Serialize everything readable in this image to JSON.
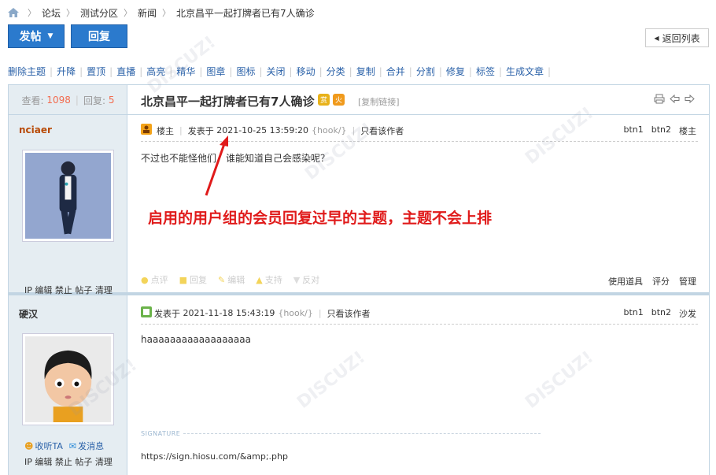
{
  "breadcrumb": {
    "items": [
      "论坛",
      "测试分区",
      "新闻",
      "北京昌平一起打牌者已有7人确诊"
    ]
  },
  "toolbar": {
    "post_label": "发帖",
    "reply_label": "回复",
    "back_label": "返回列表"
  },
  "admin_links": [
    "删除主题",
    "升降",
    "置顶",
    "直播",
    "高亮",
    "精华",
    "图章",
    "图标",
    "关闭",
    "移动",
    "分类",
    "复制",
    "合并",
    "分割",
    "修复",
    "标签",
    "生成文章"
  ],
  "thread": {
    "views_label": "查看:",
    "views": "1098",
    "replies_label": "回复:",
    "replies": "5",
    "title": "北京昌平一起打牌者已有7人确诊",
    "copy_link": "[复制链接]"
  },
  "posts": [
    {
      "author": "nciaer",
      "floor_label": "楼主",
      "posted_prefix": "发表于",
      "time": "2021-10-25 13:59:20",
      "hook": "{hook/}",
      "only_author": "只看该作者",
      "btn1": "btn1",
      "btn2": "btn2",
      "floor_name": "楼主",
      "body": "不过也不能怪他们，谁能知道自己会感染呢？",
      "side_actions": "IP 编辑 禁止 帖子 清理",
      "foot": [
        "点评",
        "回复",
        "编辑",
        "支持",
        "反对"
      ],
      "foot_right": [
        "使用道具",
        "评分",
        "管理"
      ]
    },
    {
      "author": "硬汉",
      "posted_prefix": "发表于",
      "time": "2021-11-18 15:43:19",
      "hook": "{hook/}",
      "only_author": "只看该作者",
      "btn1": "btn1",
      "btn2": "btn2",
      "floor_name": "沙发",
      "body": "haaaaaaaaaaaaaaaaaa",
      "signature_label": "SIGNATURE",
      "signature": "https://sign.hiosu.com/&amp;.php",
      "follow": "收听TA",
      "message": "发消息",
      "side_actions": "IP 编辑 禁止 帖子 清理"
    }
  ],
  "annotation": "启用的用户组的会员回复过早的主题，主题不会上排",
  "colors": {
    "primary": "#2b7acd",
    "side_bg": "#e5edf2",
    "border": "#c2d5e3",
    "author": "#b84a06",
    "annotation": "#e01a1a",
    "link": "#2a61a8"
  }
}
